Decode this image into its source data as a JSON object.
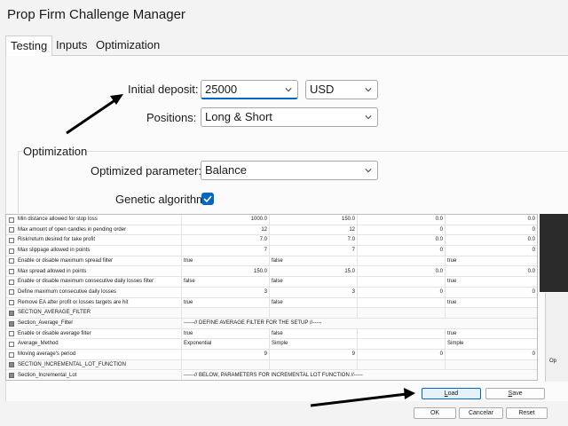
{
  "window": {
    "title": "Prop Firm Challenge Manager"
  },
  "tabs": [
    {
      "label": "Testing",
      "active": true
    },
    {
      "label": "Inputs",
      "active": false
    },
    {
      "label": "Optimization",
      "active": false
    }
  ],
  "testing": {
    "initial_deposit_label": "Initial deposit:",
    "initial_deposit_value": "25000",
    "currency_value": "USD",
    "positions_label": "Positions:",
    "positions_value": "Long & Short",
    "optimization_group_label": "Optimization",
    "optimized_parameter_label": "Optimized parameter:",
    "optimized_parameter_value": "Balance",
    "genetic_algorithm_label": "Genetic algorithm",
    "genetic_algorithm_checked": true
  },
  "grid": {
    "rows": [
      {
        "name": "Min distance allowed for stop loss",
        "v1": "1000.0",
        "v2": "150.0",
        "v3": "0.0",
        "v4": "0.0",
        "section": false
      },
      {
        "name": "Max amount of open candles in pending order",
        "v1": "12",
        "v2": "12",
        "v3": "0",
        "v4": "0",
        "section": false
      },
      {
        "name": "Risk/return desired for take profit",
        "v1": "7.0",
        "v2": "7.0",
        "v3": "0.0",
        "v4": "0.0",
        "section": false
      },
      {
        "name": "Max slippage allowed in points",
        "v1": "7",
        "v2": "7",
        "v3": "0",
        "v4": "0",
        "section": false
      },
      {
        "name": "Enable or disable maximum spread filter",
        "v1": "true",
        "v2": "false",
        "v3": "",
        "v4": "true",
        "section": false,
        "text": true
      },
      {
        "name": "Max spread allowed in points",
        "v1": "150.0",
        "v2": "15.0",
        "v3": "0.0",
        "v4": "0.0",
        "section": false
      },
      {
        "name": "Enable or disable maximum consecutive daily losses filter",
        "v1": "false",
        "v2": "false",
        "v3": "",
        "v4": "true",
        "section": false,
        "text": true
      },
      {
        "name": "Define maximum consecutive daily losses",
        "v1": "3",
        "v2": "3",
        "v3": "0",
        "v4": "0",
        "section": false
      },
      {
        "name": "Remove EA after profit or losses targets are hit",
        "v1": "true",
        "v2": "false",
        "v3": "",
        "v4": "true",
        "section": false,
        "text": true
      },
      {
        "name": "SECTION_AVERAGE_FILTER",
        "v1": "",
        "v2": "",
        "v3": "",
        "v4": "",
        "section": true,
        "text": true
      },
      {
        "name": "Section_Average_Filter",
        "span": "------// DEFINE AVERAGE FILTER FOR THE SETUP //-----",
        "section": true
      },
      {
        "name": "Enable or disable average filter",
        "v1": "true",
        "v2": "false",
        "v3": "",
        "v4": "true",
        "section": false,
        "text": true
      },
      {
        "name": "Average_Method",
        "v1": "Exponential",
        "v2": "Simple",
        "v3": "",
        "v4": "Simple",
        "section": false,
        "text": true
      },
      {
        "name": "Moving average's period",
        "v1": "9",
        "v2": "9",
        "v3": "0",
        "v4": "0",
        "section": false
      },
      {
        "name": "SECTION_INCREMENTAL_LOT_FUNCTION",
        "v1": "",
        "v2": "",
        "v3": "",
        "v4": "",
        "section": true,
        "text": true
      },
      {
        "name": "Section_Incremental_Lot",
        "span": "------// BELOW, PARAMETERS FOR INCREMENTAL LOT FUNCTION //-----",
        "section": true
      }
    ]
  },
  "side_label": "Op",
  "buttons": {
    "load": "Load",
    "save": "Save",
    "ok": "OK",
    "cancel": "Cancelar",
    "reset": "Reset"
  },
  "colors": {
    "accent": "#0067c0",
    "arrow": "#000000"
  }
}
